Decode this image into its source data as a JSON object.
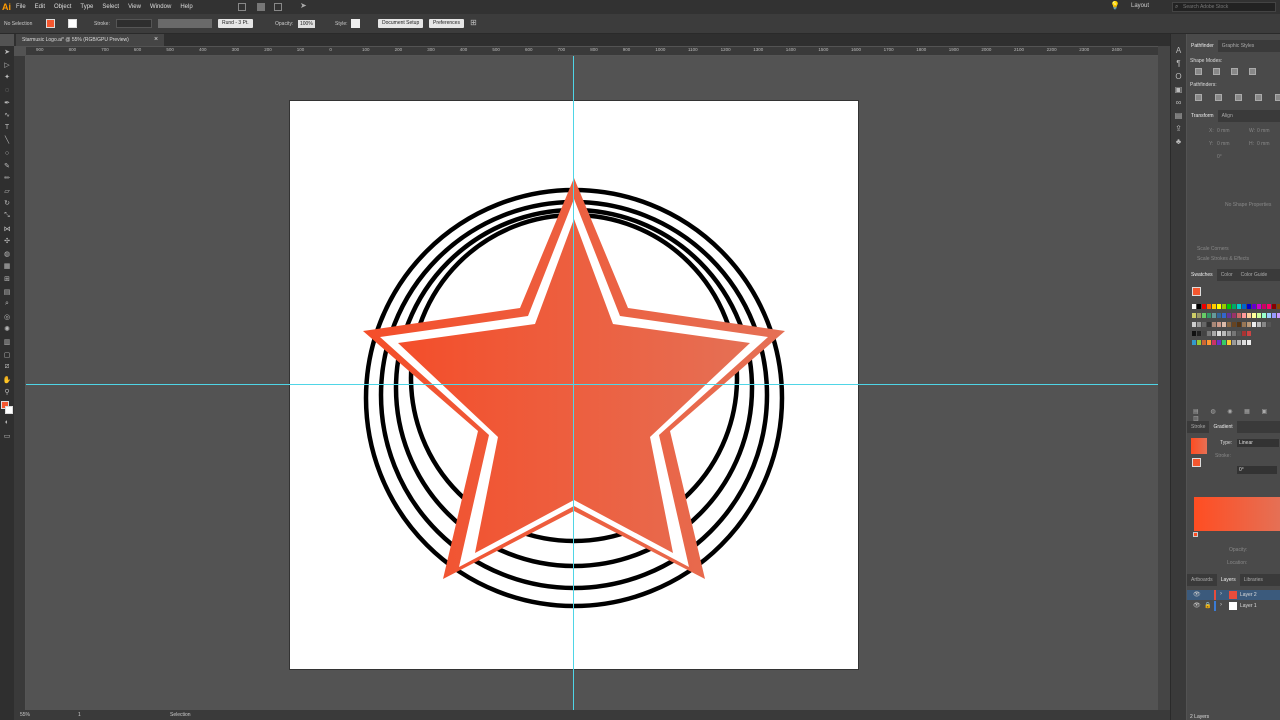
{
  "app": {
    "logo": "Ai",
    "menus": [
      "File",
      "Edit",
      "Object",
      "Type",
      "Select",
      "View",
      "Window",
      "Help"
    ],
    "workspace": "Layout",
    "search_placeholder": "Search Adobe Stock"
  },
  "control_bar": {
    "selection": "No Selection",
    "stroke_label": "Stroke:",
    "brush": "Rund - 3 Pt.",
    "opacity_label": "Opacity:",
    "opacity": "100%",
    "style_label": "Style:",
    "doc_setup": "Document Setup",
    "preferences": "Preferences"
  },
  "document": {
    "tab": "Starmusic Logo.ai* @ 55% (RGB/GPU Preview)",
    "close": "×"
  },
  "ruler_labels": [
    "900",
    "800",
    "700",
    "600",
    "500",
    "400",
    "300",
    "200",
    "100",
    "0",
    "100",
    "200",
    "300",
    "400",
    "500",
    "600",
    "700",
    "800",
    "900",
    "1000",
    "1100",
    "1200",
    "1300",
    "1400",
    "1500",
    "1600",
    "1700",
    "1800",
    "1900",
    "2000",
    "2100",
    "2200",
    "2300",
    "2400"
  ],
  "artwork": {
    "star_colors": [
      "#f44e2a",
      "#e57055"
    ],
    "ring_color": "#000000"
  },
  "colors": {
    "accent": "#4fd5e6",
    "fill": "#f4572f"
  },
  "status": {
    "zoom": "55%",
    "page": "1",
    "mode": "Selection"
  },
  "pathfinder": {
    "tabs": [
      "Pathfinder",
      "Graphic Styles"
    ],
    "shape_modes": "Shape Modes:",
    "pathfinders": "Pathfinders:"
  },
  "transform": {
    "tabs": [
      "Transform",
      "Align"
    ],
    "x": "X:",
    "y": "Y:",
    "w": "W:",
    "h": "H:",
    "x_val": "0 mm",
    "y_val": "0 mm",
    "w_val": "0 mm",
    "h_val": "0 mm",
    "rot": "0°",
    "no_props": "No Shape Properties",
    "scale_corners": "Scale Corners",
    "scale_strokes": "Scale Strokes & Effects"
  },
  "swatches": {
    "tabs": [
      "Swatches",
      "Color",
      "Color Guide"
    ],
    "row1": [
      "#fff",
      "#000",
      "#e00",
      "#f60",
      "#fc0",
      "#ff0",
      "#9c0",
      "#0c0",
      "#0a6",
      "#0cc",
      "#06c",
      "#00c",
      "#60c",
      "#c0c",
      "#c06",
      "#f06",
      "#800",
      "#840"
    ],
    "row2": [
      "#cc6",
      "#996",
      "#6c6",
      "#396",
      "#699",
      "#369",
      "#36c",
      "#639",
      "#936",
      "#c66",
      "#f99",
      "#fc9",
      "#ff9",
      "#cf9",
      "#9fc",
      "#9cf",
      "#99f",
      "#c9f"
    ],
    "row3": [
      "#ccc",
      "#999",
      "#666",
      "#333",
      "#a87",
      "#c98",
      "#dba",
      "#864",
      "#642",
      "#531",
      "#975",
      "#b97",
      "#eee",
      "#bbb",
      "#888",
      "#555"
    ],
    "row4": [
      "#111",
      "#222",
      "#444",
      "#777",
      "#aaa",
      "#ddd",
      "#bbb",
      "#999",
      "#777",
      "#555",
      "#a33",
      "#c44"
    ],
    "row5": [
      "#39c",
      "#9c3",
      "#c63",
      "#f93",
      "#c36",
      "#63c",
      "#3c6",
      "#fc3",
      "#999",
      "#bbb",
      "#ddd",
      "#eee"
    ]
  },
  "gradient": {
    "tabs": [
      "Stroke",
      "Gradient"
    ],
    "type_label": "Type:",
    "type": "Linear",
    "stroke_label": "Stroke:",
    "angle": "0°",
    "opacity_label": "Opacity:",
    "location_label": "Location:",
    "start": "#ff4d22",
    "end": "#e57055"
  },
  "layers": {
    "tabs": [
      "Artboards",
      "Layers",
      "Libraries"
    ],
    "items": [
      {
        "name": "Layer 2",
        "color": "#e74c3c"
      },
      {
        "name": "Layer 1",
        "color": "#ffffff"
      }
    ],
    "count": "2 Layers"
  }
}
